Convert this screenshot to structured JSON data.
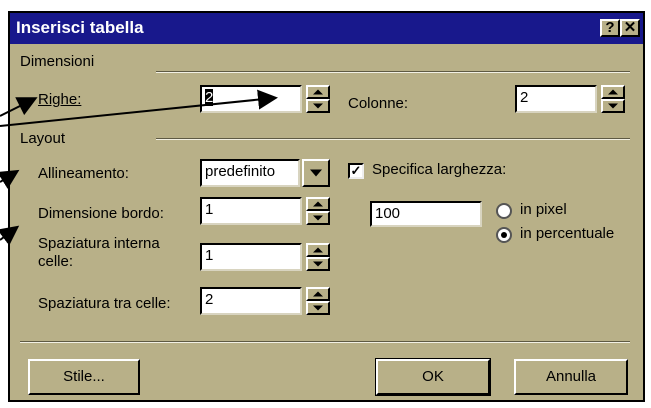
{
  "window": {
    "title": "Inserisci tabella",
    "help_glyph": "?",
    "close_glyph": "✕"
  },
  "dimensions": {
    "group_label": "Dimensioni",
    "rows_label": "Righe:",
    "rows_value": "2",
    "cols_label": "Colonne:",
    "cols_value": "2"
  },
  "layout": {
    "group_label": "Layout",
    "align_label": "Allineamento:",
    "align_value": "predefinito",
    "border_label": "Dimensione bordo:",
    "border_value": "1",
    "padding_label_line1": "Spaziatura interna",
    "padding_label_line2": "celle:",
    "padding_value": "1",
    "spacing_label": "Spaziatura tra celle:",
    "spacing_value": "2",
    "width_check_label": "Specifica larghezza:",
    "width_checked": true,
    "width_value": "100",
    "pixel_label": "in pixel",
    "percent_label": "in percentuale",
    "unit_selected": "percent"
  },
  "buttons": {
    "style": "Stile...",
    "ok": "OK",
    "cancel": "Annulla"
  },
  "colors": {
    "dialog_bg": "#b8b088",
    "titlebar": "#18188c"
  }
}
